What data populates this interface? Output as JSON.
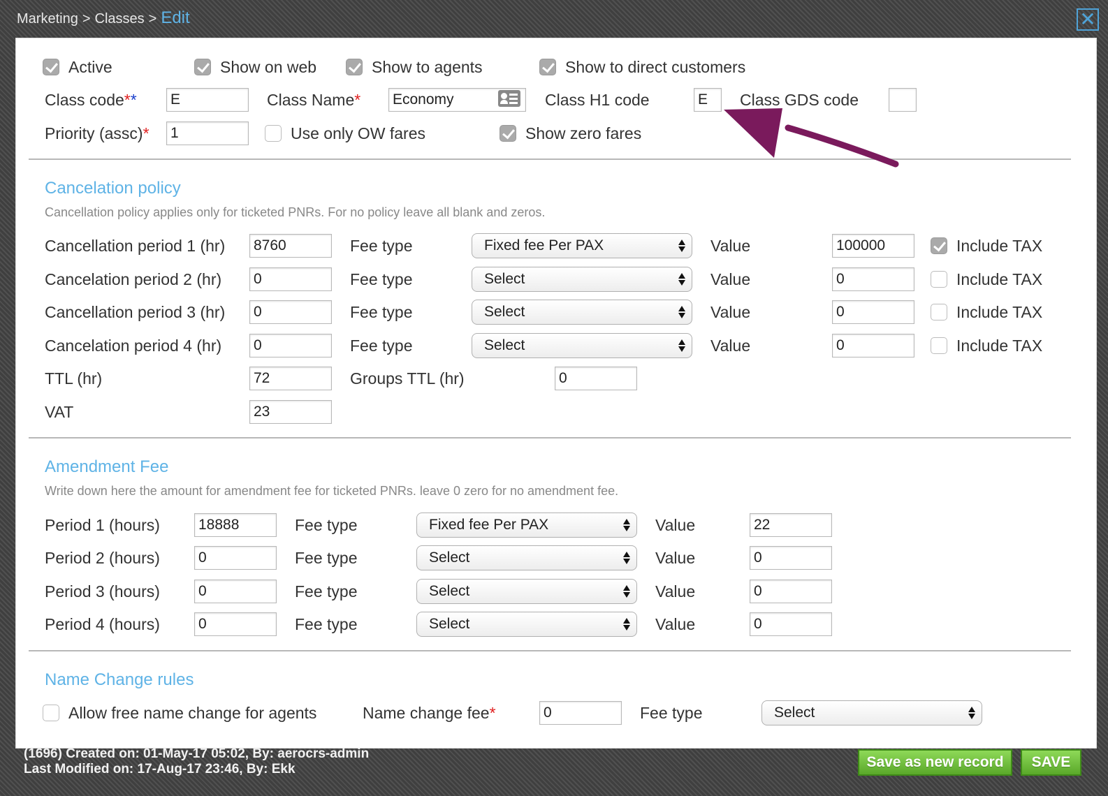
{
  "breadcrumb": {
    "items": [
      "Marketing",
      "Classes"
    ],
    "separator": ">",
    "current": "Edit"
  },
  "close_icon": "✕",
  "top": {
    "active": {
      "label": "Active",
      "checked": true
    },
    "show_on_web": {
      "label": "Show on web",
      "checked": true
    },
    "show_to_agents": {
      "label": "Show to agents",
      "checked": true
    },
    "show_to_direct": {
      "label": "Show to direct customers",
      "checked": true
    },
    "class_code": {
      "label": "Class code",
      "req1": "*",
      "req2": "*",
      "value": "E"
    },
    "class_name": {
      "label": "Class Name",
      "req": "*",
      "value": "Economy"
    },
    "class_h1": {
      "label": "Class H1 code",
      "value": "E"
    },
    "class_gds": {
      "label": "Class GDS code",
      "value": ""
    },
    "priority": {
      "label": "Priority (assc)",
      "req": "*",
      "value": "1"
    },
    "ow_fares": {
      "label": "Use only OW fares",
      "checked": false
    },
    "zero_fares": {
      "label": "Show zero fares",
      "checked": true
    }
  },
  "cancel": {
    "title": "Cancelation policy",
    "desc": "Cancellation policy applies only for ticketed PNRs. For no policy leave all blank and zeros.",
    "fee_type_label": "Fee type",
    "value_label": "Value",
    "include_tax_label": "Include TAX",
    "rows": [
      {
        "label": "Cancellation period 1 (hr)",
        "hours": "8760",
        "fee_type": "Fixed fee Per PAX",
        "value": "100000",
        "include_tax": true
      },
      {
        "label": "Cancelation period 2 (hr)",
        "hours": "0",
        "fee_type": "Select",
        "value": "0",
        "include_tax": false
      },
      {
        "label": "Cancellation period 3 (hr)",
        "hours": "0",
        "fee_type": "Select",
        "value": "0",
        "include_tax": false
      },
      {
        "label": "Cancelation period 4 (hr)",
        "hours": "0",
        "fee_type": "Select",
        "value": "0",
        "include_tax": false
      }
    ],
    "ttl": {
      "label": "TTL (hr)",
      "value": "72"
    },
    "groups_ttl": {
      "label": "Groups TTL (hr)",
      "value": "0"
    },
    "vat": {
      "label": "VAT",
      "value": "23"
    }
  },
  "amend": {
    "title": "Amendment Fee",
    "desc": "Write down here the amount for amendment fee for ticketed PNRs. leave 0 zero for no amendment fee.",
    "fee_type_label": "Fee type",
    "value_label": "Value",
    "rows": [
      {
        "label": "Period 1 (hours)",
        "hours": "18888",
        "fee_type": "Fixed fee Per PAX",
        "value": "22"
      },
      {
        "label": "Period 2 (hours)",
        "hours": "0",
        "fee_type": "Select",
        "value": "0"
      },
      {
        "label": "Period 3 (hours)",
        "hours": "0",
        "fee_type": "Select",
        "value": "0"
      },
      {
        "label": "Period 4 (hours)",
        "hours": "0",
        "fee_type": "Select",
        "value": "0"
      }
    ]
  },
  "name_change": {
    "title": "Name Change rules",
    "allow_free": {
      "label": "Allow free name change for agents",
      "checked": false
    },
    "fee": {
      "label": "Name change fee",
      "req": "*",
      "value": "0"
    },
    "fee_type": {
      "label": "Fee type",
      "value": "Select"
    }
  },
  "footer": {
    "created": "(1696) Created on: 01-May-17 05:02, By: aerocrs-admin",
    "modified": "Last Modified on: 17-Aug-17 23:46, By: Ekk",
    "save_new_label": "Save as new record",
    "save_label": "SAVE"
  },
  "colors": {
    "accent": "#5fb3e6",
    "annotation_arrow": "#7a1a5c",
    "button_green": "#6cbf3a",
    "required": "#e02020"
  }
}
